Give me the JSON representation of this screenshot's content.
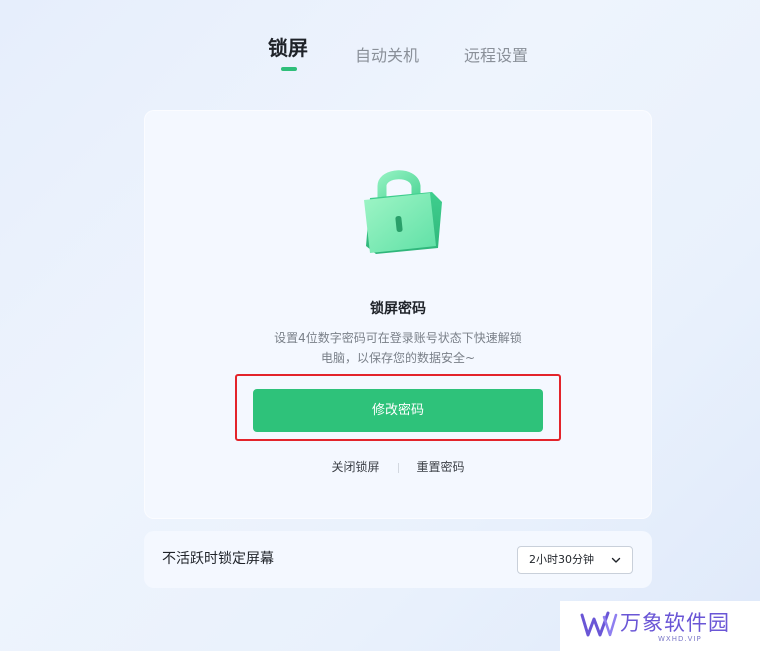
{
  "tabs": [
    {
      "label": "锁屏",
      "active": true
    },
    {
      "label": "自动关机",
      "active": false
    },
    {
      "label": "远程设置",
      "active": false
    }
  ],
  "lock_card": {
    "icon": "padlock-icon",
    "title": "锁屏密码",
    "desc_line1": "设置4位数字密码可在登录账号状态下快速解锁",
    "desc_line2": "电脑，以保存您的数据安全~",
    "primary_button": "修改密码",
    "link_close": "关闭锁屏",
    "link_reset": "重置密码"
  },
  "idle_lock": {
    "label": "不活跃时锁定屏幕",
    "selected": "2小时30分钟"
  },
  "watermark": {
    "text": "万象软件园",
    "sub": "WXHD.VIP"
  },
  "colors": {
    "accent": "#2ec27a",
    "highlight": "#e3242b"
  }
}
